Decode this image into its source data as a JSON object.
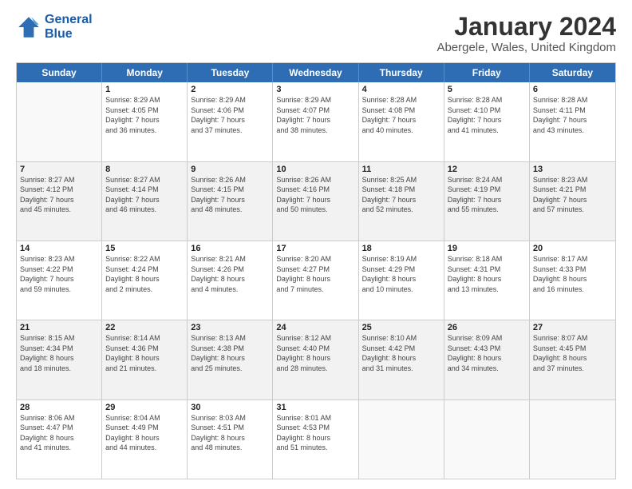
{
  "logo": {
    "line1": "General",
    "line2": "Blue"
  },
  "title": "January 2024",
  "subtitle": "Abergele, Wales, United Kingdom",
  "header_days": [
    "Sunday",
    "Monday",
    "Tuesday",
    "Wednesday",
    "Thursday",
    "Friday",
    "Saturday"
  ],
  "weeks": [
    [
      {
        "num": "",
        "info": ""
      },
      {
        "num": "1",
        "info": "Sunrise: 8:29 AM\nSunset: 4:05 PM\nDaylight: 7 hours\nand 36 minutes."
      },
      {
        "num": "2",
        "info": "Sunrise: 8:29 AM\nSunset: 4:06 PM\nDaylight: 7 hours\nand 37 minutes."
      },
      {
        "num": "3",
        "info": "Sunrise: 8:29 AM\nSunset: 4:07 PM\nDaylight: 7 hours\nand 38 minutes."
      },
      {
        "num": "4",
        "info": "Sunrise: 8:28 AM\nSunset: 4:08 PM\nDaylight: 7 hours\nand 40 minutes."
      },
      {
        "num": "5",
        "info": "Sunrise: 8:28 AM\nSunset: 4:10 PM\nDaylight: 7 hours\nand 41 minutes."
      },
      {
        "num": "6",
        "info": "Sunrise: 8:28 AM\nSunset: 4:11 PM\nDaylight: 7 hours\nand 43 minutes."
      }
    ],
    [
      {
        "num": "7",
        "info": "Sunrise: 8:27 AM\nSunset: 4:12 PM\nDaylight: 7 hours\nand 45 minutes."
      },
      {
        "num": "8",
        "info": "Sunrise: 8:27 AM\nSunset: 4:14 PM\nDaylight: 7 hours\nand 46 minutes."
      },
      {
        "num": "9",
        "info": "Sunrise: 8:26 AM\nSunset: 4:15 PM\nDaylight: 7 hours\nand 48 minutes."
      },
      {
        "num": "10",
        "info": "Sunrise: 8:26 AM\nSunset: 4:16 PM\nDaylight: 7 hours\nand 50 minutes."
      },
      {
        "num": "11",
        "info": "Sunrise: 8:25 AM\nSunset: 4:18 PM\nDaylight: 7 hours\nand 52 minutes."
      },
      {
        "num": "12",
        "info": "Sunrise: 8:24 AM\nSunset: 4:19 PM\nDaylight: 7 hours\nand 55 minutes."
      },
      {
        "num": "13",
        "info": "Sunrise: 8:23 AM\nSunset: 4:21 PM\nDaylight: 7 hours\nand 57 minutes."
      }
    ],
    [
      {
        "num": "14",
        "info": "Sunrise: 8:23 AM\nSunset: 4:22 PM\nDaylight: 7 hours\nand 59 minutes."
      },
      {
        "num": "15",
        "info": "Sunrise: 8:22 AM\nSunset: 4:24 PM\nDaylight: 8 hours\nand 2 minutes."
      },
      {
        "num": "16",
        "info": "Sunrise: 8:21 AM\nSunset: 4:26 PM\nDaylight: 8 hours\nand 4 minutes."
      },
      {
        "num": "17",
        "info": "Sunrise: 8:20 AM\nSunset: 4:27 PM\nDaylight: 8 hours\nand 7 minutes."
      },
      {
        "num": "18",
        "info": "Sunrise: 8:19 AM\nSunset: 4:29 PM\nDaylight: 8 hours\nand 10 minutes."
      },
      {
        "num": "19",
        "info": "Sunrise: 8:18 AM\nSunset: 4:31 PM\nDaylight: 8 hours\nand 13 minutes."
      },
      {
        "num": "20",
        "info": "Sunrise: 8:17 AM\nSunset: 4:33 PM\nDaylight: 8 hours\nand 16 minutes."
      }
    ],
    [
      {
        "num": "21",
        "info": "Sunrise: 8:15 AM\nSunset: 4:34 PM\nDaylight: 8 hours\nand 18 minutes."
      },
      {
        "num": "22",
        "info": "Sunrise: 8:14 AM\nSunset: 4:36 PM\nDaylight: 8 hours\nand 21 minutes."
      },
      {
        "num": "23",
        "info": "Sunrise: 8:13 AM\nSunset: 4:38 PM\nDaylight: 8 hours\nand 25 minutes."
      },
      {
        "num": "24",
        "info": "Sunrise: 8:12 AM\nSunset: 4:40 PM\nDaylight: 8 hours\nand 28 minutes."
      },
      {
        "num": "25",
        "info": "Sunrise: 8:10 AM\nSunset: 4:42 PM\nDaylight: 8 hours\nand 31 minutes."
      },
      {
        "num": "26",
        "info": "Sunrise: 8:09 AM\nSunset: 4:43 PM\nDaylight: 8 hours\nand 34 minutes."
      },
      {
        "num": "27",
        "info": "Sunrise: 8:07 AM\nSunset: 4:45 PM\nDaylight: 8 hours\nand 37 minutes."
      }
    ],
    [
      {
        "num": "28",
        "info": "Sunrise: 8:06 AM\nSunset: 4:47 PM\nDaylight: 8 hours\nand 41 minutes."
      },
      {
        "num": "29",
        "info": "Sunrise: 8:04 AM\nSunset: 4:49 PM\nDaylight: 8 hours\nand 44 minutes."
      },
      {
        "num": "30",
        "info": "Sunrise: 8:03 AM\nSunset: 4:51 PM\nDaylight: 8 hours\nand 48 minutes."
      },
      {
        "num": "31",
        "info": "Sunrise: 8:01 AM\nSunset: 4:53 PM\nDaylight: 8 hours\nand 51 minutes."
      },
      {
        "num": "",
        "info": ""
      },
      {
        "num": "",
        "info": ""
      },
      {
        "num": "",
        "info": ""
      }
    ]
  ]
}
